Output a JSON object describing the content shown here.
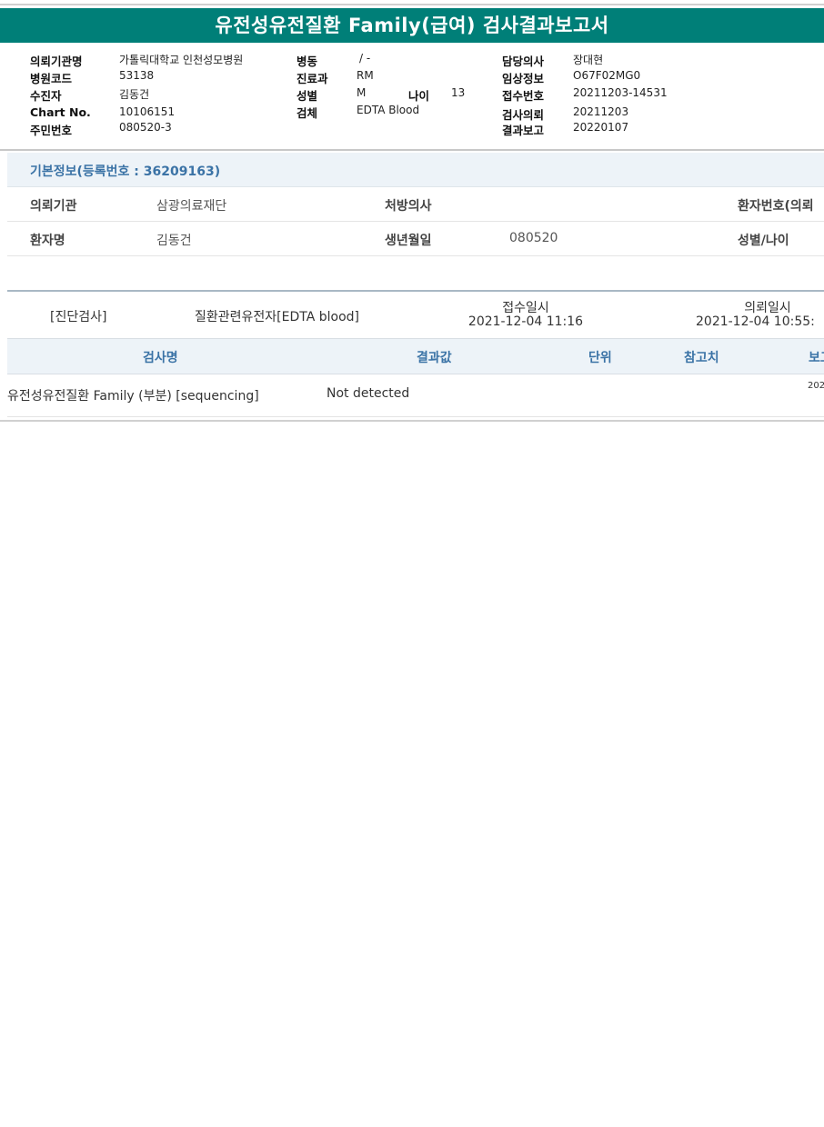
{
  "title": "유전성유전질환 Family(급여) 검사결과보고서",
  "header_info": {
    "col1": [
      {
        "label": "의뢰기관명",
        "value": "가톨릭대학교 인천성모병원"
      },
      {
        "label": "병원코드",
        "value": "53138"
      },
      {
        "label": "수진자",
        "value": "김동건"
      },
      {
        "label": "Chart No.",
        "value": "10106151"
      },
      {
        "label": "주민번호",
        "value": "080520-3"
      }
    ],
    "col2": [
      {
        "label": "병동",
        "value": "/ -"
      },
      {
        "label": "진료과",
        "value": "RM"
      },
      {
        "label": "성별",
        "value": "M"
      },
      {
        "label": "검체",
        "value": "EDTA Blood"
      }
    ],
    "age": {
      "label": "나이",
      "value": "13"
    },
    "col3": [
      {
        "label": "담당의사",
        "value": "장대현"
      },
      {
        "label": "임상정보",
        "value": "O67F02MG0"
      },
      {
        "label": "접수번호",
        "value": "20211203-14531"
      },
      {
        "label": "검사의뢰",
        "value": "20211203"
      },
      {
        "label": "결과보고",
        "value": "20220107"
      }
    ]
  },
  "basic_info": {
    "title": "기본정보(등록번호 : 36209163)",
    "row1": {
      "label1": "의뢰기관",
      "value1": "삼광의료재단",
      "label2": "처방의사",
      "value2": "",
      "label3": "환자번호(의뢰"
    },
    "row2": {
      "label1": "환자명",
      "value1": "김동건",
      "label2": "생년월일",
      "value2": "080520",
      "label3": "성별/나이"
    }
  },
  "order": {
    "category": "[진단검사]",
    "test_group": "질환관련유전자[EDTA blood]",
    "received_label": "접수일시",
    "received_value": "2021-12-04  11:16",
    "requested_label": "의뢰일시",
    "requested_value": "2021-12-04  10:55:"
  },
  "results": {
    "headers": {
      "name": "검사명",
      "result": "결과값",
      "unit": "단위",
      "reference": "참고치",
      "report": "보고"
    },
    "rows": [
      {
        "name": "유전성유전질환 Family (부분) [sequencing]",
        "result": "Not detected",
        "unit": "",
        "reference": "",
        "report": "202"
      }
    ]
  },
  "colors": {
    "title_bar": "#007f78",
    "section_text": "#3b73a6",
    "section_bg": "#edf3f8"
  }
}
